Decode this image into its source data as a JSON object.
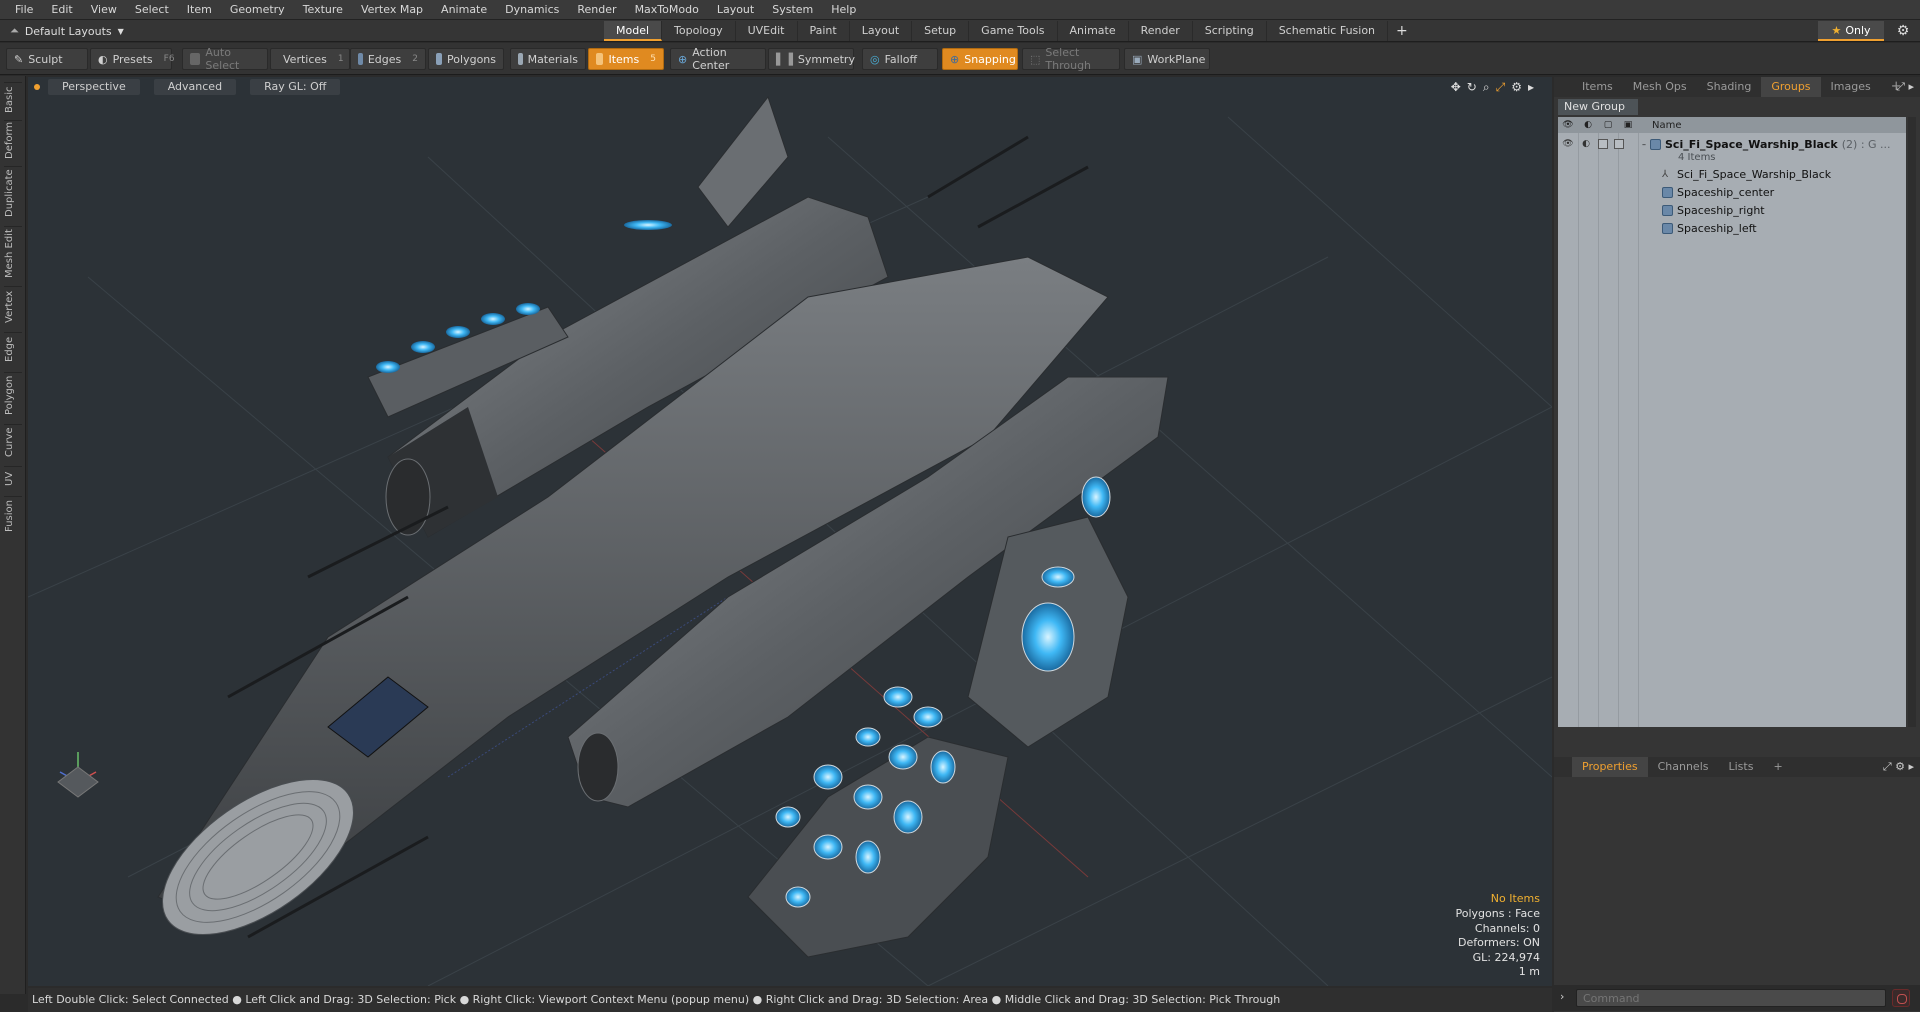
{
  "menubar": {
    "items": [
      "File",
      "Edit",
      "View",
      "Select",
      "Item",
      "Geometry",
      "Texture",
      "Vertex Map",
      "Animate",
      "Dynamics",
      "Render",
      "MaxToModo",
      "Layout",
      "System",
      "Help"
    ]
  },
  "layoutbar": {
    "layout_selector": "Default Layouts",
    "tabs": [
      {
        "label": "Model",
        "active": true
      },
      {
        "label": "Topology"
      },
      {
        "label": "UVEdit"
      },
      {
        "label": "Paint"
      },
      {
        "label": "Layout"
      },
      {
        "label": "Setup"
      },
      {
        "label": "Game Tools"
      },
      {
        "label": "Animate"
      },
      {
        "label": "Render"
      },
      {
        "label": "Scripting"
      },
      {
        "label": "Schematic Fusion"
      }
    ],
    "add_tab": "+",
    "only_label": "Only"
  },
  "toolbar": {
    "sculpt": "Sculpt",
    "presets": "Presets",
    "presets_key": "F6",
    "auto_select": "Auto Select",
    "vertices": "Vertices",
    "vertices_count": "1",
    "edges": "Edges",
    "edges_count": "2",
    "polygons": "Polygons",
    "materials": "Materials",
    "items": "Items",
    "items_count": "5",
    "action_center": "Action Center",
    "symmetry": "Symmetry",
    "falloff": "Falloff",
    "snapping": "Snapping",
    "select_through": "Select Through",
    "workplane": "WorkPlane"
  },
  "leftstrip": {
    "tabs": [
      "Basic",
      "Deform",
      "Duplicate",
      "Mesh Edit",
      "Vertex",
      "Edge",
      "Polygon",
      "Curve",
      "UV",
      "Fusion"
    ]
  },
  "viewport": {
    "view_mode": "Perspective",
    "shading": "Advanced",
    "raygl": "Ray GL: Off",
    "info": {
      "no_items": "No Items",
      "polygons": "Polygons : Face",
      "channels": "Channels: 0",
      "deformers": "Deformers: ON",
      "gl": "GL: 224,974",
      "scale": "1 m"
    }
  },
  "statusbar": {
    "text": "Left Double Click: Select Connected ● Left Click and Drag: 3D Selection: Pick ● Right Click: Viewport Context Menu (popup menu) ● Right Click and Drag: 3D Selection: Area ● Middle Click and Drag: 3D Selection: Pick Through"
  },
  "rightpanel": {
    "tabs": [
      {
        "label": "Items"
      },
      {
        "label": "Mesh Ops"
      },
      {
        "label": "Shading"
      },
      {
        "label": "Groups",
        "active": true
      },
      {
        "label": "Images"
      }
    ],
    "new_group": "New Group",
    "column_name": "Name",
    "tree": {
      "group_name": "Sci_Fi_Space_Warship_Black",
      "group_suffix": "(2) : G ...",
      "group_count": "4 Items",
      "children": [
        "Sci_Fi_Space_Warship_Black",
        "Spaceship_center",
        "Spaceship_right",
        "Spaceship_left"
      ]
    },
    "bottom_tabs": [
      {
        "label": "Properties",
        "active": true
      },
      {
        "label": "Channels"
      },
      {
        "label": "Lists"
      }
    ],
    "command_placeholder": "Command"
  },
  "colors": {
    "accent": "#f0a030",
    "viewport_bg": "#2c3237",
    "engine_glow": "#3fb8f5"
  }
}
